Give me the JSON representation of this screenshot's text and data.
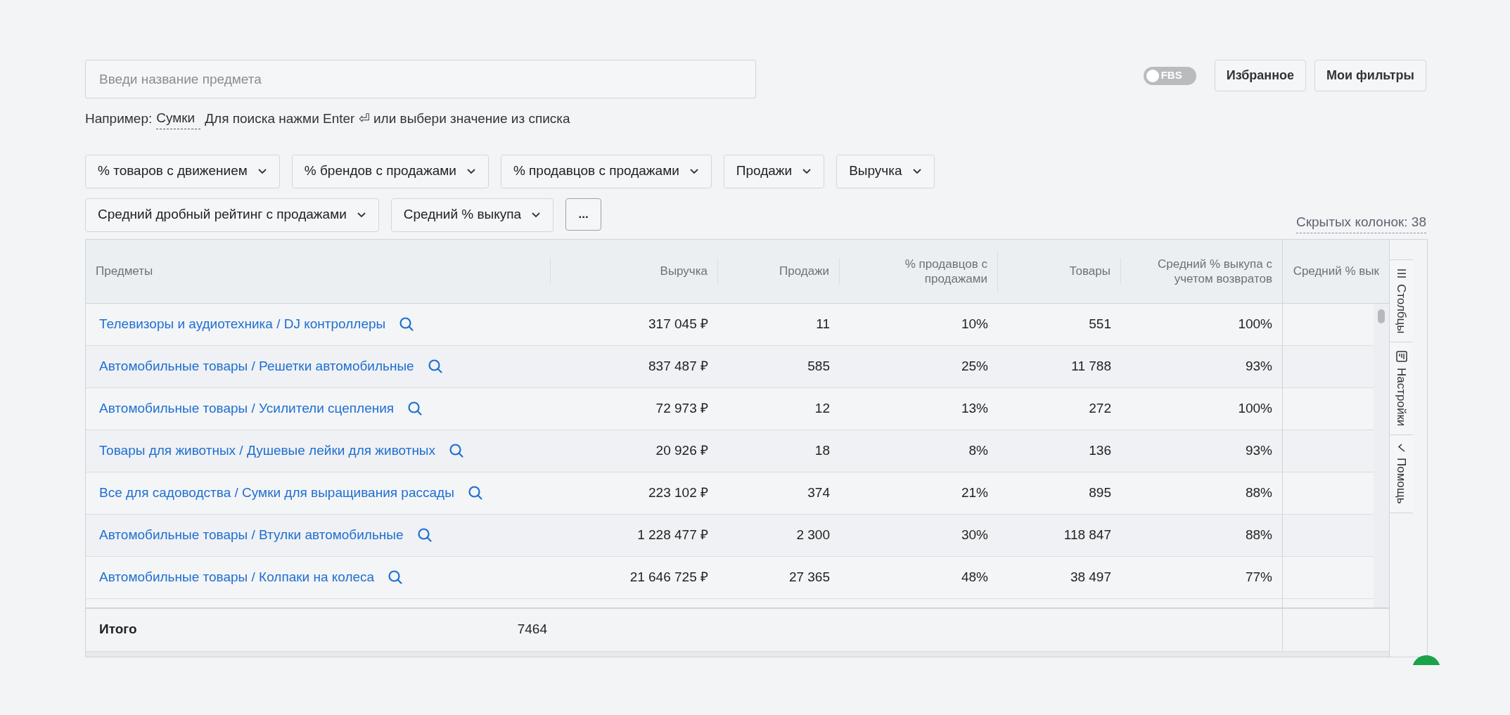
{
  "search": {
    "placeholder": "Введи название предмета"
  },
  "hint": {
    "prefix": "Например:",
    "example": "Сумки",
    "text": "Для поиска нажми Enter ⏎ или выбери значение из списка"
  },
  "fbs_toggle": {
    "label": "FBS",
    "on": false
  },
  "top_buttons": [
    "Избранное",
    "Мои фильтры"
  ],
  "filters": [
    {
      "label": "% товаров с движением",
      "kind": "dropdown"
    },
    {
      "label": "% брендов с продажами",
      "kind": "dropdown"
    },
    {
      "label": "% продавцов с продажами",
      "kind": "dropdown"
    },
    {
      "label": "Продажи",
      "kind": "dropdown"
    },
    {
      "label": "Выручка",
      "kind": "dropdown"
    },
    {
      "label": "Средний дробный рейтинг с продажами",
      "kind": "dropdown"
    },
    {
      "label": "Средний % выкупа",
      "kind": "dropdown"
    },
    {
      "label": "...",
      "kind": "more"
    }
  ],
  "hidden_columns": "Скрытых колонок: 38",
  "table": {
    "columns": [
      "Предметы",
      "Выручка",
      "Продажи",
      "% продавцов с продажами",
      "Товары",
      "Средний % выкупа с учетом возвратов",
      "Средний % вык"
    ],
    "rows": [
      {
        "cells": [
          "Телевизоры и аудиотехника / DJ контроллеры",
          "317 045 ₽",
          "11",
          "10%",
          "551",
          "100%"
        ]
      },
      {
        "cells": [
          "Автомобильные товары / Решетки автомобильные",
          "837 487 ₽",
          "585",
          "25%",
          "11 788",
          "93%"
        ]
      },
      {
        "cells": [
          "Автомобильные товары / Усилители сцепления",
          "72 973 ₽",
          "12",
          "13%",
          "272",
          "100%"
        ]
      },
      {
        "cells": [
          "Товары для животных / Душевые лейки для животных",
          "20 926 ₽",
          "18",
          "8%",
          "136",
          "93%"
        ]
      },
      {
        "cells": [
          "Все для садоводства / Сумки для выращивания рассады",
          "223 102 ₽",
          "374",
          "21%",
          "895",
          "88%"
        ]
      },
      {
        "cells": [
          "Автомобильные товары / Втулки автомобильные",
          "1 228 477 ₽",
          "2 300",
          "30%",
          "118 847",
          "88%"
        ]
      },
      {
        "cells": [
          "Автомобильные товары / Колпаки на колеса",
          "21 646 725 ₽",
          "27 365",
          "48%",
          "38 497",
          "77%"
        ]
      }
    ],
    "total": {
      "label": "Итого",
      "count": "7464"
    }
  },
  "side_tabs": [
    {
      "label": "Столбцы",
      "kind": "columns"
    },
    {
      "label": "Настройки",
      "kind": "settings"
    },
    {
      "label": "Помощь",
      "kind": "help"
    }
  ]
}
